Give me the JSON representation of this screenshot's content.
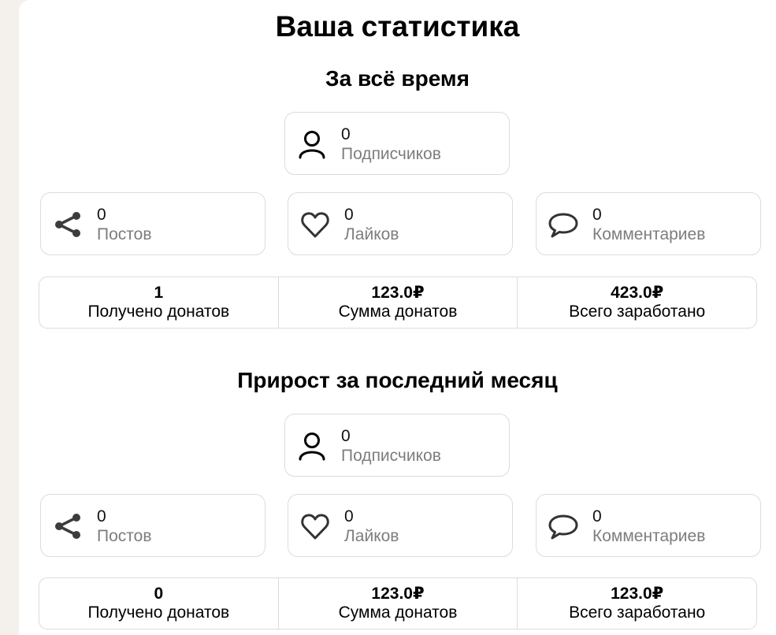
{
  "page": {
    "title": "Ваша статистика"
  },
  "sections": [
    {
      "title": "За всё время",
      "subscribers": {
        "value": "0",
        "label": "Подписчиков"
      },
      "posts": {
        "value": "0",
        "label": "Постов"
      },
      "likes": {
        "value": "0",
        "label": "Лайков"
      },
      "comments": {
        "value": "0",
        "label": "Комментариев"
      },
      "donations": [
        {
          "value": "1",
          "label": "Получено донатов"
        },
        {
          "value": "123.0₽",
          "label": "Сумма донатов"
        },
        {
          "value": "423.0₽",
          "label": "Всего заработано"
        }
      ]
    },
    {
      "title": "Прирост за последний месяц",
      "subscribers": {
        "value": "0",
        "label": "Подписчиков"
      },
      "posts": {
        "value": "0",
        "label": "Постов"
      },
      "likes": {
        "value": "0",
        "label": "Лайков"
      },
      "comments": {
        "value": "0",
        "label": "Комментариев"
      },
      "donations": [
        {
          "value": "0",
          "label": "Получено донатов"
        },
        {
          "value": "123.0₽",
          "label": "Сумма донатов"
        },
        {
          "value": "123.0₽",
          "label": "Всего заработано"
        }
      ]
    }
  ]
}
